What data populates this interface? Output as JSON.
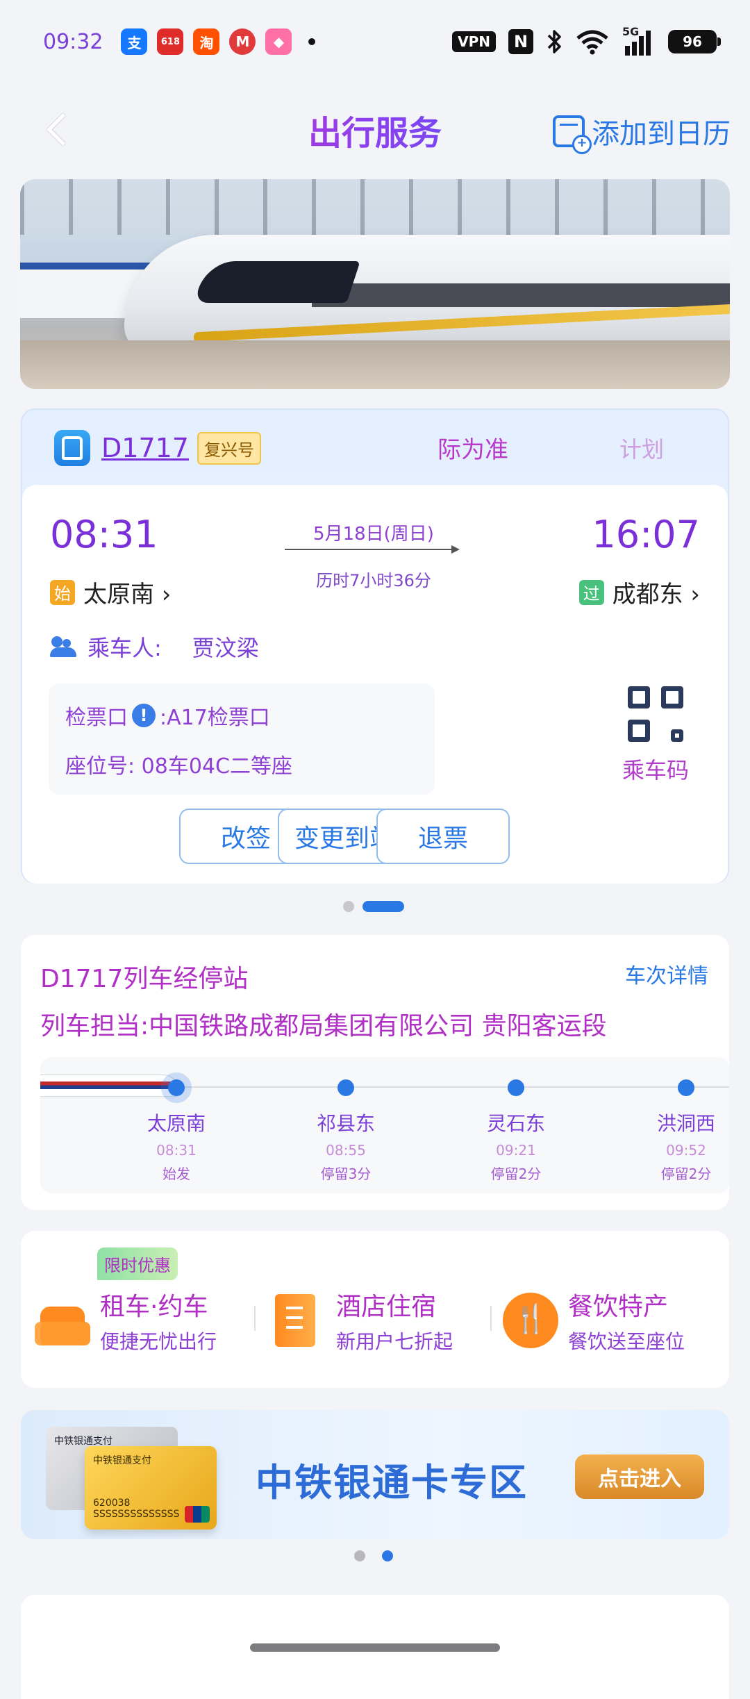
{
  "status_bar": {
    "time": "09:32",
    "apps": [
      {
        "name": "alipay-app-icon",
        "glyph": "支",
        "color": "#1677ff"
      },
      {
        "name": "618-app-icon",
        "glyph": "618",
        "color": "#e02b2b"
      },
      {
        "name": "taobao-app-icon",
        "glyph": "淘",
        "color": "#ff5000"
      },
      {
        "name": "metro-app-icon",
        "glyph": "M",
        "color": "#e03a3a"
      },
      {
        "name": "pink-app-icon",
        "glyph": "◆",
        "color": "#ff6fa8"
      }
    ],
    "vpn": "VPN",
    "nfc": "N",
    "network": "5G",
    "battery": "96"
  },
  "header": {
    "title": "出行服务",
    "add_calendar": "添加到日历"
  },
  "ticket": {
    "train_number": "D1717",
    "train_type": "复兴号",
    "notice": "际为准",
    "notice_trailing": "计划",
    "depart_time": "08:31",
    "arrive_time": "16:07",
    "date": "5月18日(周日)",
    "duration": "历时7小时36分",
    "from_tag": "始",
    "from_station": "太原南 ›",
    "to_tag": "过",
    "to_station": "成都东 ›",
    "passenger_label": "乘车人:",
    "passenger_name": "贾汶梁",
    "gate_label": "检票口",
    "gate_value": ":A17检票口",
    "seat": "座位号: 08车04C二等座",
    "qr_label": "乘车码",
    "actions": [
      "改签",
      "变更到站",
      "退票"
    ]
  },
  "stops": {
    "title": "D1717列车经停站",
    "detail_link": "车次详情",
    "operator": "列车担当:中国铁路成都局集团有限公司 贵阳客运段",
    "list": [
      {
        "name": "太原南",
        "time": "08:31",
        "note": "始发"
      },
      {
        "name": "祁县东",
        "time": "08:55",
        "note": "停留3分"
      },
      {
        "name": "灵石东",
        "time": "09:21",
        "note": "停留2分"
      },
      {
        "name": "洪洞西",
        "time": "09:52",
        "note": "停留2分"
      }
    ]
  },
  "services": {
    "promo_tag": "限时优惠",
    "items": [
      {
        "title": "租车·约车",
        "subtitle": "便捷无忧出行",
        "icon": "taxi-icon"
      },
      {
        "title": "酒店住宿",
        "subtitle": "新用户七折起",
        "icon": "hotel-icon"
      },
      {
        "title": "餐饮特产",
        "subtitle": "餐饮送至座位",
        "icon": "dining-icon"
      }
    ]
  },
  "bank_banner": {
    "title": "中铁银通卡专区",
    "button": "点击进入",
    "card_label": "中铁银通支付",
    "card_number": "620038 SSSSSSSSSSSSSS"
  },
  "colors": {
    "accent_blue": "#2a78e4",
    "text_purple": "#7a3fd6",
    "text_magenta": "#b02fc4",
    "orange": "#ff8a1f"
  }
}
